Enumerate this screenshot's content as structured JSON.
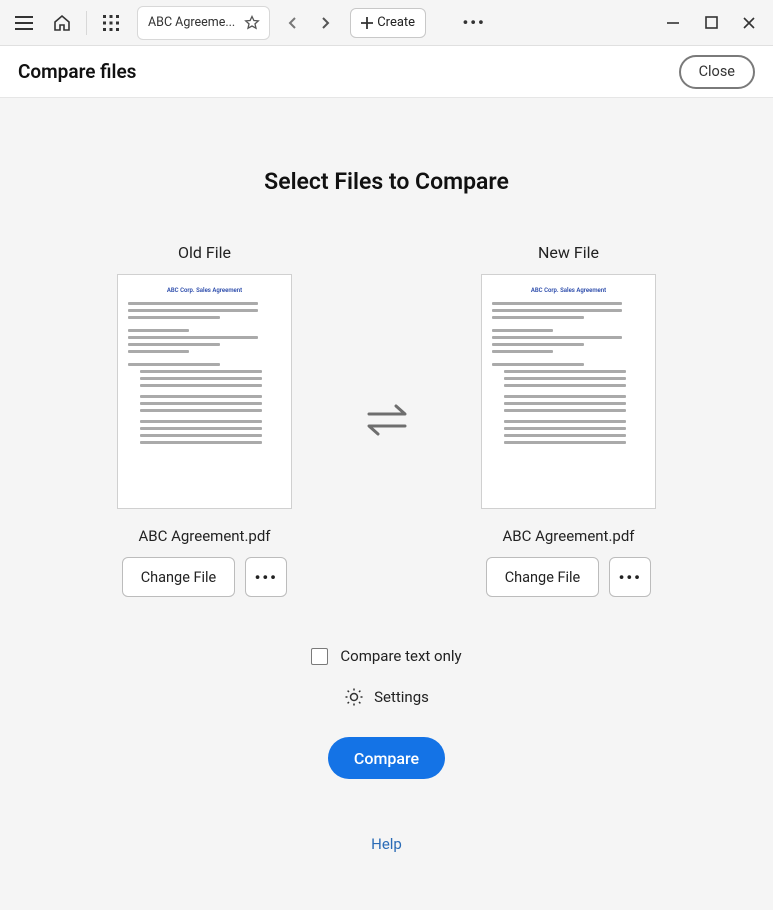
{
  "toolbar": {
    "tab_title": "ABC Agreeme...",
    "create_label": "Create"
  },
  "header": {
    "title": "Compare files",
    "close_label": "Close"
  },
  "main": {
    "heading": "Select Files to Compare",
    "old_label": "Old File",
    "new_label": "New File",
    "doc_title": "ABC Corp. Sales Agreement",
    "old_filename": "ABC Agreement.pdf",
    "new_filename": "ABC Agreement.pdf",
    "change_file_label": "Change File",
    "compare_text_only_label": "Compare text only",
    "settings_label": "Settings",
    "compare_button_label": "Compare",
    "help_label": "Help"
  }
}
